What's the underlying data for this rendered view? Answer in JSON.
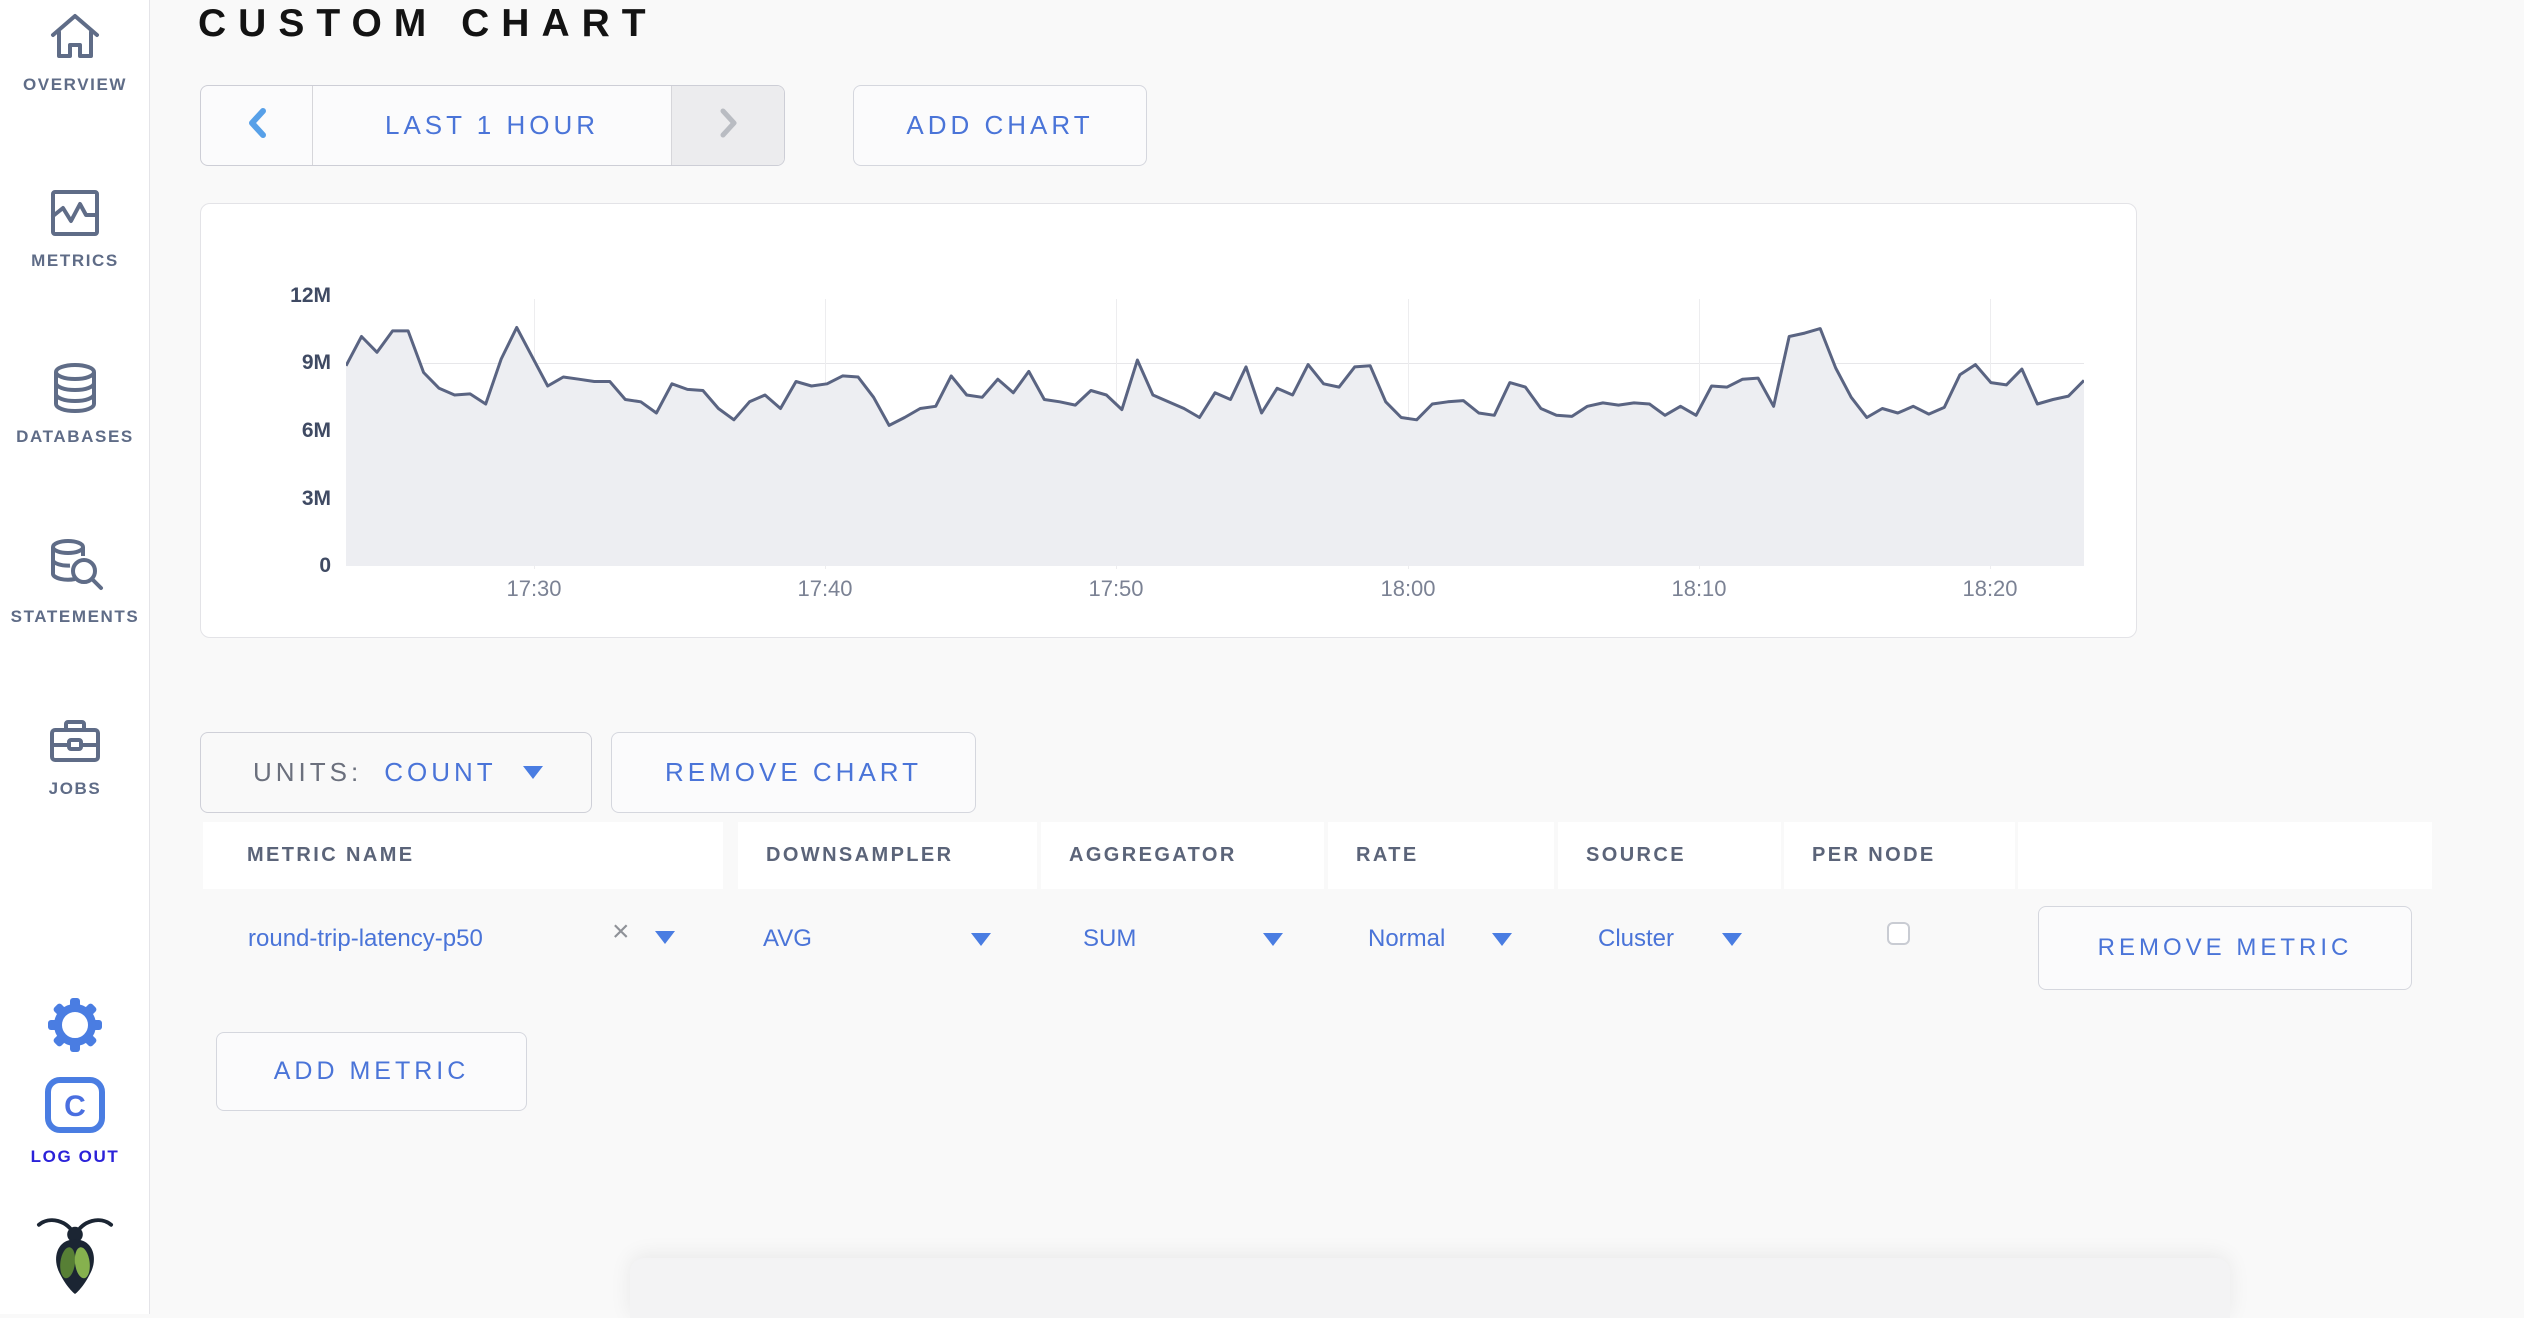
{
  "sidebar": {
    "items": [
      {
        "icon": "home-icon",
        "label": "OVERVIEW"
      },
      {
        "icon": "metrics-icon",
        "label": "METRICS"
      },
      {
        "icon": "database-icon",
        "label": "DATABASES"
      },
      {
        "icon": "statements-icon",
        "label": "STATEMENTS"
      },
      {
        "icon": "jobs-icon",
        "label": "JOBS"
      }
    ],
    "settings_icon": "gear-icon",
    "logout": {
      "icon": "cockroach-c-icon",
      "label": "LOG OUT"
    },
    "logo_icon": "cockroachdb-bug-logo"
  },
  "header": {
    "title": "CUSTOM CHART"
  },
  "toolbar": {
    "time_range_label": "LAST 1 HOUR",
    "prev_icon": "chevron-left-icon",
    "next_icon": "chevron-right-icon",
    "add_chart_label": "ADD CHART"
  },
  "chart_controls": {
    "units_label": "UNITS:",
    "units_value": "COUNT",
    "remove_chart_label": "REMOVE CHART",
    "add_metric_label": "ADD METRIC"
  },
  "chart_data": {
    "type": "area",
    "title": "",
    "xlabel": "",
    "ylabel": "",
    "unit": "count",
    "value_unit": "millions",
    "ylim": [
      0,
      12
    ],
    "yticks": [
      "0",
      "3M",
      "6M",
      "9M",
      "12M"
    ],
    "xticks": [
      "17:30",
      "17:40",
      "17:50",
      "18:00",
      "18:10",
      "18:20"
    ],
    "x_range": [
      "17:23",
      "18:23"
    ],
    "grid": true,
    "legend": false,
    "series": [
      {
        "name": "round-trip-latency-p50",
        "values": [
          8.9,
          10.2,
          9.5,
          10.45,
          10.45,
          8.6,
          7.9,
          7.6,
          7.65,
          7.2,
          9.2,
          10.6,
          9.3,
          8.0,
          8.4,
          8.3,
          8.2,
          8.2,
          7.4,
          7.3,
          6.8,
          8.1,
          7.85,
          7.8,
          7.0,
          6.5,
          7.3,
          7.6,
          7.0,
          8.2,
          8.0,
          8.1,
          8.45,
          8.4,
          7.5,
          6.25,
          6.6,
          7.0,
          7.1,
          8.45,
          7.6,
          7.5,
          8.3,
          7.7,
          8.65,
          7.4,
          7.3,
          7.15,
          7.8,
          7.6,
          6.95,
          9.15,
          7.6,
          7.3,
          7.0,
          6.6,
          7.7,
          7.4,
          8.85,
          6.8,
          7.9,
          7.6,
          8.95,
          8.1,
          7.95,
          8.85,
          8.9,
          7.3,
          6.6,
          6.5,
          7.2,
          7.3,
          7.35,
          6.8,
          6.7,
          8.15,
          7.95,
          7.0,
          6.7,
          6.65,
          7.1,
          7.25,
          7.15,
          7.25,
          7.2,
          6.7,
          7.1,
          6.7,
          8.0,
          7.95,
          8.3,
          8.35,
          7.1,
          10.2,
          10.35,
          10.55,
          8.8,
          7.5,
          6.6,
          7.0,
          6.8,
          7.1,
          6.75,
          7.05,
          8.5,
          8.95,
          8.15,
          8.05,
          8.75,
          7.2,
          7.4,
          7.55,
          8.25
        ]
      }
    ]
  },
  "metric_table": {
    "headers": [
      "METRIC NAME",
      "DOWNSAMPLER",
      "AGGREGATOR",
      "RATE",
      "SOURCE",
      "PER NODE",
      ""
    ],
    "rows": [
      {
        "metric_name": "round-trip-latency-p50",
        "remove_symbol": "×",
        "downsampler": "AVG",
        "aggregator": "SUM",
        "rate": "Normal",
        "source": "Cluster",
        "per_node_checked": false,
        "remove_metric_label": "REMOVE METRIC"
      }
    ]
  },
  "colors": {
    "accent_blue": "#4a74d8",
    "icon_blue": "#4a7de2",
    "logout_blue": "#2b22d9",
    "sidebar_gray": "#5f6c87",
    "chart_line": "#5a6482",
    "chart_fill": "#edeef2",
    "page_bg": "#f9f9f9"
  }
}
